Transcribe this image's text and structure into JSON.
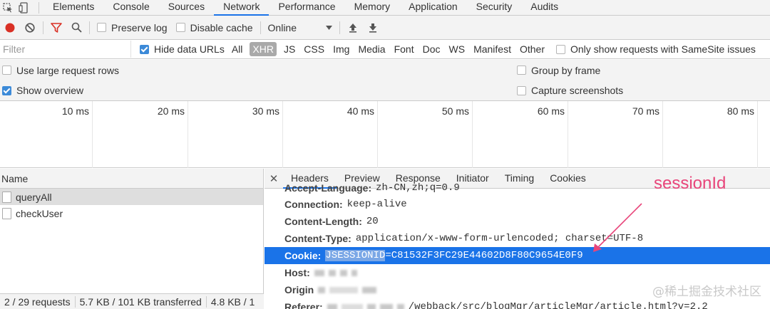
{
  "tabs": [
    "Elements",
    "Console",
    "Sources",
    "Network",
    "Performance",
    "Memory",
    "Application",
    "Security",
    "Audits"
  ],
  "toolbar": {
    "preserve_log": "Preserve log",
    "disable_cache": "Disable cache",
    "throttling": "Online"
  },
  "filter": {
    "placeholder": "Filter",
    "hide_data_urls": "Hide data URLs",
    "types": [
      "All",
      "XHR",
      "JS",
      "CSS",
      "Img",
      "Media",
      "Font",
      "Doc",
      "WS",
      "Manifest",
      "Other"
    ],
    "samesite": "Only show requests with SameSite issues"
  },
  "options": {
    "large_rows": "Use large request rows",
    "group_by_frame": "Group by frame",
    "show_overview": "Show overview",
    "capture_screenshots": "Capture screenshots"
  },
  "overview": {
    "ticks": [
      "10 ms",
      "20 ms",
      "30 ms",
      "40 ms",
      "50 ms",
      "60 ms",
      "70 ms",
      "80 ms"
    ]
  },
  "requests": {
    "header": "Name",
    "items": [
      "queryAll",
      "checkUser"
    ]
  },
  "status": {
    "requests": "2 / 29 requests",
    "transferred": "5.7 KB / 101 KB transferred",
    "resources": "4.8 KB / 1"
  },
  "detail": {
    "tabs": [
      "Headers",
      "Preview",
      "Response",
      "Initiator",
      "Timing",
      "Cookies"
    ],
    "headers": [
      {
        "key": "Accept-Language:",
        "value": "zh-CN,zh;q=0.9"
      },
      {
        "key": "Connection:",
        "value": "keep-alive"
      },
      {
        "key": "Content-Length:",
        "value": "20"
      },
      {
        "key": "Content-Type:",
        "value": "application/x-www-form-urlencoded; charset=UTF-8"
      },
      {
        "key": "Cookie:",
        "value_sel": "JSESSIONID",
        "value": "=C81532F3FC29E44602D8F80C9654E0F9"
      },
      {
        "key": "Host:",
        "value": ""
      },
      {
        "key": "Origin",
        "value": ""
      },
      {
        "key": "Referer:",
        "value": "/webback/src/blogMgr/articleMgr/article.html?v=2.2"
      }
    ]
  },
  "annotation": "sessionId",
  "watermark": "@稀土掘金技术社区",
  "colors": {
    "accent": "#1a73e8",
    "annotation": "#e8457a",
    "record": "#d93025",
    "filter_icon": "#d93025"
  }
}
